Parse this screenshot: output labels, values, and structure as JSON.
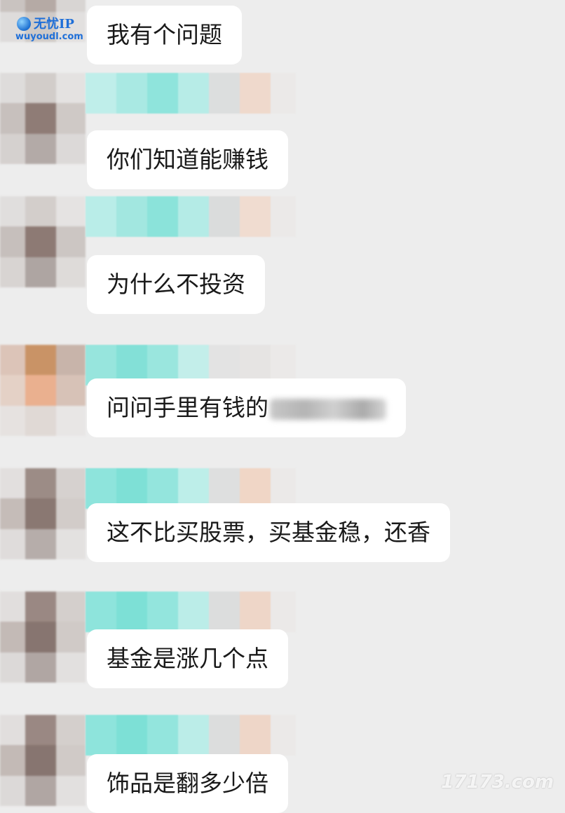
{
  "messages": [
    {
      "text": "我有个问题"
    },
    {
      "text": "你们知道能赚钱"
    },
    {
      "text": "为什么不投资"
    },
    {
      "text": "问问手里有钱的",
      "redacted_suffix": true
    },
    {
      "text": "这不比买股票，买基金稳，还香"
    },
    {
      "text": "基金是涨几个点"
    },
    {
      "text": "饰品是翻多少倍"
    }
  ],
  "watermarks": {
    "logo_brand": "无忧IP",
    "logo_domain": "wuyoudl.com",
    "site": "17173.com"
  },
  "colors": {
    "background": "#ededed",
    "bubble": "#ffffff",
    "text": "#191919",
    "nickname_mosaic": "#79e0d8",
    "watermark_blue": "#1f6fd8"
  }
}
